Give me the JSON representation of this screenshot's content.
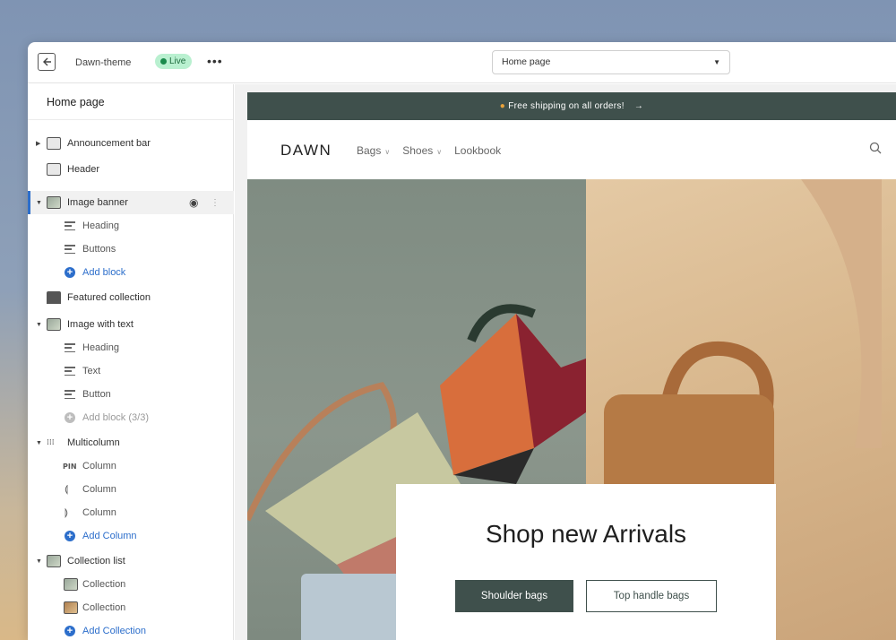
{
  "topbar": {
    "theme_name": "Dawn-theme",
    "live_badge": "Live",
    "more": "•••",
    "page_select": "Home page"
  },
  "sidebar": {
    "title": "Home page",
    "items": [
      {
        "label": "Announcement bar"
      },
      {
        "label": "Header"
      },
      {
        "label": "Image banner"
      },
      {
        "label": "Heading"
      },
      {
        "label": "Buttons"
      },
      {
        "label": "Add block"
      },
      {
        "label": "Featured collection"
      },
      {
        "label": "Image with text"
      },
      {
        "label": "Heading"
      },
      {
        "label": "Text"
      },
      {
        "label": "Button"
      },
      {
        "label": "Add block (3/3)"
      },
      {
        "label": "Multicolumn"
      },
      {
        "label": "Column"
      },
      {
        "label": "Column"
      },
      {
        "label": "Column"
      },
      {
        "label": "Add Column"
      },
      {
        "label": "Collection list"
      },
      {
        "label": "Collection"
      },
      {
        "label": "Collection"
      },
      {
        "label": "Add Collection"
      }
    ]
  },
  "store": {
    "announcement": "Free shipping on all orders!",
    "announcement_arrow": "→",
    "logo": "DAWN",
    "nav": [
      "Bags",
      "Shoes",
      "Lookbook"
    ],
    "banner_heading": "Shop new Arrivals",
    "button_primary": "Shoulder bags",
    "button_secondary": "Top handle bags"
  },
  "colors": {
    "accent_blue": "#2c6ecb",
    "brand_dark_green": "#3f504c",
    "live_green": "#1a8a4c"
  }
}
